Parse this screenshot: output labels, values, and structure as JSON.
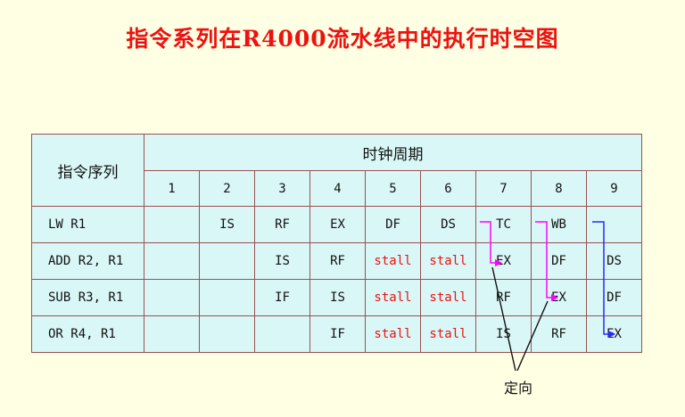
{
  "title": "指令系列在R4000流水线中的执行时空图",
  "table": {
    "row_header": "指令序列",
    "col_header": "时钟周期",
    "cycles": [
      "1",
      "2",
      "3",
      "4",
      "5",
      "6",
      "7",
      "8",
      "9"
    ],
    "rows": [
      {
        "instr": "LW R1",
        "cells": [
          "",
          "IS",
          "RF",
          "EX",
          "DF",
          "DS",
          "TC",
          "WB",
          ""
        ]
      },
      {
        "instr": "ADD R2, R1",
        "cells": [
          "",
          "",
          "IS",
          "RF",
          "stall",
          "stall",
          "EX",
          "DF",
          "DS"
        ]
      },
      {
        "instr": "SUB R3, R1",
        "cells": [
          "",
          "",
          "IF",
          "IS",
          "stall",
          "stall",
          "RF",
          "EX",
          "DF"
        ]
      },
      {
        "instr": "OR R4, R1",
        "cells": [
          "",
          "",
          "",
          "IF",
          "stall",
          "stall",
          "IS",
          "RF",
          "EX"
        ]
      }
    ]
  },
  "annotation": "定向",
  "colors": {
    "stall": "#ee1111",
    "title": "#ee1111",
    "arrow_1": "#ff00ff",
    "arrow_2": "#ff00ff",
    "arrow_3": "#2a2aff",
    "table_bg": "#d9f7f7",
    "page_bg": "#ffffe3"
  }
}
